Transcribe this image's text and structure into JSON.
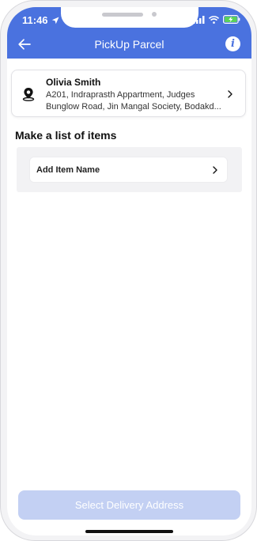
{
  "status_bar": {
    "time": "11:46",
    "icons": [
      "location-arrow-icon",
      "signal-icon",
      "wifi-icon",
      "battery-charging-icon"
    ]
  },
  "header": {
    "title": "PickUp Parcel",
    "back_icon": "back-arrow-icon",
    "info_icon_glyph": "i",
    "background_color": "#4a72df"
  },
  "pickup_address": {
    "icon": "location-pin-icon",
    "name": "Olivia Smith",
    "line1": "A201, Indraprasth Appartment, Judges",
    "line2": "Bunglow Road, Jin Mangal Society, Bodakd..."
  },
  "items_section": {
    "title": "Make a list of items",
    "add_item_label": "Add Item Name"
  },
  "footer": {
    "button_label": "Select Delivery Address",
    "button_color": "#c3d0f3"
  }
}
